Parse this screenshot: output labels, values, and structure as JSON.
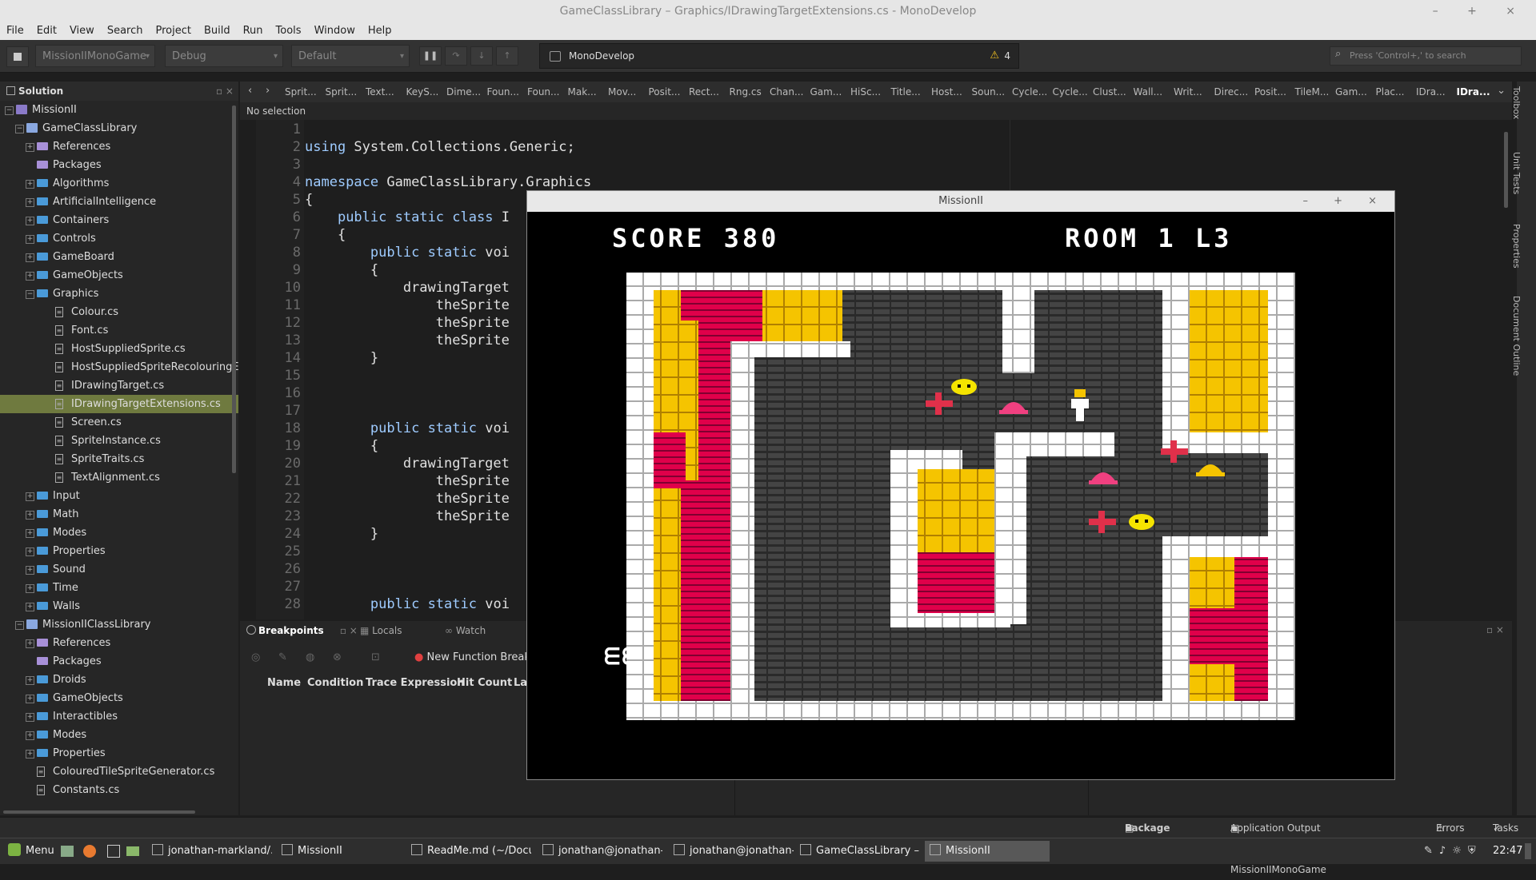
{
  "window": {
    "title": "GameClassLibrary – Graphics/IDrawingTargetExtensions.cs - MonoDevelop",
    "controls": [
      "–",
      "+",
      "×"
    ]
  },
  "menu": [
    "File",
    "Edit",
    "View",
    "Search",
    "Project",
    "Build",
    "Run",
    "Tools",
    "Window",
    "Help"
  ],
  "toolbar": {
    "project": "MissionIIMonoGame",
    "config": "Debug",
    "target": "Default",
    "status_app": "MonoDevelop",
    "warning_count": "4",
    "search_placeholder": "Press 'Control+,' to search"
  },
  "solution": {
    "title": "Solution",
    "rows": [
      {
        "label": "MissionII",
        "depth": 0,
        "kind": "solution",
        "exp": "−"
      },
      {
        "label": "GameClassLibrary",
        "depth": 1,
        "kind": "project",
        "exp": "−"
      },
      {
        "label": "References",
        "depth": 2,
        "kind": "purple",
        "exp": "+"
      },
      {
        "label": "Packages",
        "depth": 2,
        "kind": "purple",
        "exp": ""
      },
      {
        "label": "Algorithms",
        "depth": 2,
        "kind": "folder",
        "exp": "+"
      },
      {
        "label": "ArtificialIntelligence",
        "depth": 2,
        "kind": "folder",
        "exp": "+"
      },
      {
        "label": "Containers",
        "depth": 2,
        "kind": "folder",
        "exp": "+"
      },
      {
        "label": "Controls",
        "depth": 2,
        "kind": "folder",
        "exp": "+"
      },
      {
        "label": "GameBoard",
        "depth": 2,
        "kind": "folder",
        "exp": "+"
      },
      {
        "label": "GameObjects",
        "depth": 2,
        "kind": "folder",
        "exp": "+"
      },
      {
        "label": "Graphics",
        "depth": 2,
        "kind": "folder",
        "exp": "−"
      },
      {
        "label": "Colour.cs",
        "depth": 3,
        "kind": "file",
        "exp": ""
      },
      {
        "label": "Font.cs",
        "depth": 3,
        "kind": "file",
        "exp": ""
      },
      {
        "label": "HostSuppliedSprite.cs",
        "depth": 3,
        "kind": "file",
        "exp": ""
      },
      {
        "label": "HostSuppliedSpriteRecolouringExten",
        "depth": 3,
        "kind": "file",
        "exp": ""
      },
      {
        "label": "IDrawingTarget.cs",
        "depth": 3,
        "kind": "file",
        "exp": ""
      },
      {
        "label": "IDrawingTargetExtensions.cs",
        "depth": 3,
        "kind": "file",
        "exp": "",
        "selected": true
      },
      {
        "label": "Screen.cs",
        "depth": 3,
        "kind": "file",
        "exp": ""
      },
      {
        "label": "SpriteInstance.cs",
        "depth": 3,
        "kind": "file",
        "exp": ""
      },
      {
        "label": "SpriteTraits.cs",
        "depth": 3,
        "kind": "file",
        "exp": ""
      },
      {
        "label": "TextAlignment.cs",
        "depth": 3,
        "kind": "file",
        "exp": ""
      },
      {
        "label": "Input",
        "depth": 2,
        "kind": "folder",
        "exp": "+"
      },
      {
        "label": "Math",
        "depth": 2,
        "kind": "folder",
        "exp": "+"
      },
      {
        "label": "Modes",
        "depth": 2,
        "kind": "folder",
        "exp": "+"
      },
      {
        "label": "Properties",
        "depth": 2,
        "kind": "folder",
        "exp": "+"
      },
      {
        "label": "Sound",
        "depth": 2,
        "kind": "folder",
        "exp": "+"
      },
      {
        "label": "Time",
        "depth": 2,
        "kind": "folder",
        "exp": "+"
      },
      {
        "label": "Walls",
        "depth": 2,
        "kind": "folder",
        "exp": "+"
      },
      {
        "label": "MissionIIClassLibrary",
        "depth": 1,
        "kind": "project",
        "exp": "−"
      },
      {
        "label": "References",
        "depth": 2,
        "kind": "purple",
        "exp": "+"
      },
      {
        "label": "Packages",
        "depth": 2,
        "kind": "purple",
        "exp": ""
      },
      {
        "label": "Droids",
        "depth": 2,
        "kind": "folder",
        "exp": "+"
      },
      {
        "label": "GameObjects",
        "depth": 2,
        "kind": "folder",
        "exp": "+"
      },
      {
        "label": "Interactibles",
        "depth": 2,
        "kind": "folder",
        "exp": "+"
      },
      {
        "label": "Modes",
        "depth": 2,
        "kind": "folder",
        "exp": "+"
      },
      {
        "label": "Properties",
        "depth": 2,
        "kind": "folder",
        "exp": "+"
      },
      {
        "label": "ColouredTileSpriteGenerator.cs",
        "depth": 2,
        "kind": "file",
        "exp": ""
      },
      {
        "label": "Constants.cs",
        "depth": 2,
        "kind": "file",
        "exp": ""
      }
    ]
  },
  "tabs": [
    "Sprit...",
    "Sprit...",
    "Text...",
    "KeyS...",
    "Dime...",
    "Foun...",
    "Foun...",
    "Mak...",
    "Mov...",
    "Posit...",
    "Rect...",
    "Rng.cs",
    "Chan...",
    "Gam...",
    "HiSc...",
    "Title...",
    "Host...",
    "Soun...",
    "Cycle...",
    "Cycle...",
    "Clust...",
    "Wall...",
    "Writ...",
    "Direc...",
    "Posit...",
    "TileM...",
    "Gam...",
    "Plac...",
    "IDra...",
    "IDra..."
  ],
  "editor": {
    "selection": "No selection",
    "lines": [
      {
        "n": "1",
        "t": ""
      },
      {
        "n": "2",
        "t": "using System.Collections.Generic;"
      },
      {
        "n": "3",
        "t": ""
      },
      {
        "n": "4",
        "t": "namespace GameClassLibrary.Graphics"
      },
      {
        "n": "5",
        "t": "{"
      },
      {
        "n": "6",
        "t": "    public static class I"
      },
      {
        "n": "7",
        "t": "    {"
      },
      {
        "n": "8",
        "t": "        public static voi"
      },
      {
        "n": "9",
        "t": "        {"
      },
      {
        "n": "10",
        "t": "            drawingTarget"
      },
      {
        "n": "11",
        "t": "                theSprite"
      },
      {
        "n": "12",
        "t": "                theSprite"
      },
      {
        "n": "13",
        "t": "                theSprite"
      },
      {
        "n": "14",
        "t": "        }"
      },
      {
        "n": "15",
        "t": ""
      },
      {
        "n": "16",
        "t": ""
      },
      {
        "n": "17",
        "t": ""
      },
      {
        "n": "18",
        "t": "        public static voi"
      },
      {
        "n": "19",
        "t": "        {"
      },
      {
        "n": "20",
        "t": "            drawingTarget"
      },
      {
        "n": "21",
        "t": "                theSprite"
      },
      {
        "n": "22",
        "t": "                theSprite"
      },
      {
        "n": "23",
        "t": "                theSprite"
      },
      {
        "n": "24",
        "t": "        }"
      },
      {
        "n": "25",
        "t": ""
      },
      {
        "n": "26",
        "t": ""
      },
      {
        "n": "27",
        "t": ""
      },
      {
        "n": "28",
        "t": "        public static voi"
      }
    ]
  },
  "pads": {
    "tabs": [
      "Breakpoints",
      "Locals",
      "Watch"
    ],
    "new_breakpoint": "New Function Breakpc",
    "columns": [
      "Name",
      "Condition",
      "Trace Expression",
      "Hit Count",
      "La"
    ]
  },
  "right_strip": [
    "Toolbox",
    "Unit Tests",
    "Properties",
    "Document Outline"
  ],
  "status": [
    "Package Console",
    "Application Output - MissionIIMonoGame",
    "Errors",
    "Tasks"
  ],
  "taskbar": {
    "menu": "Menu",
    "items": [
      "jonathan-markland/...",
      "MissionII",
      "ReadMe.md (~/Docu...",
      "jonathan@jonathan-...",
      "jonathan@jonathan-...",
      "GameClassLibrary – ...",
      "MissionII"
    ],
    "clock": "22:47"
  },
  "game": {
    "title": "MissionII",
    "score_label": "SCORE 380",
    "room_label": "ROOM 1 L3",
    "lives": "ᗴᗴ"
  }
}
